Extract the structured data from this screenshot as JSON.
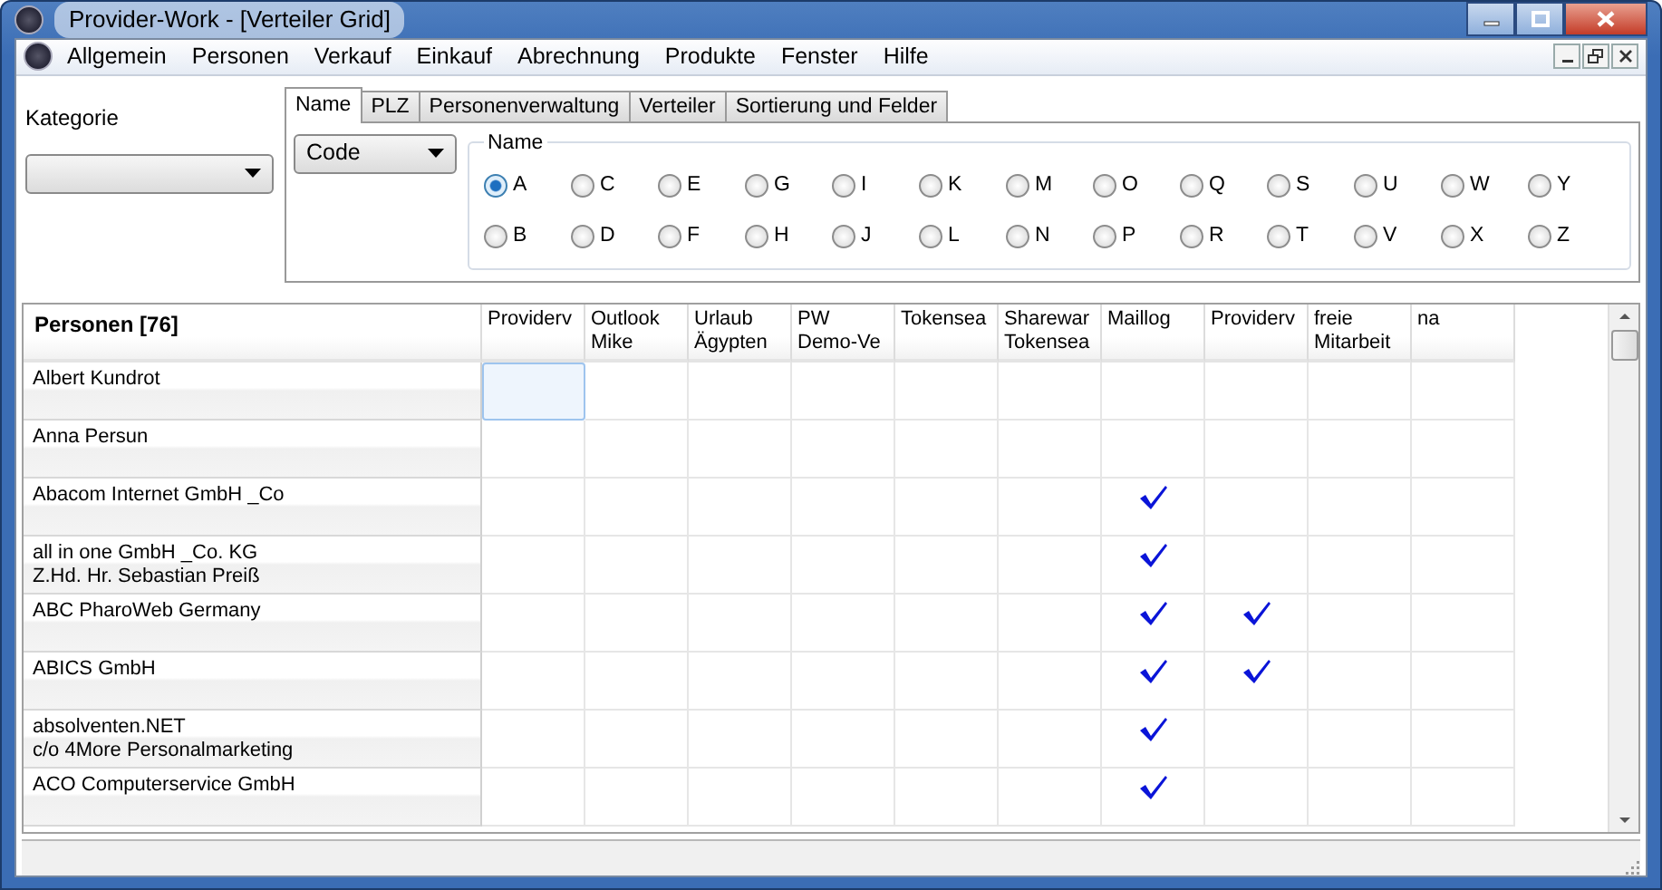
{
  "window": {
    "title": "Provider-Work - [Verteiler Grid]"
  },
  "menu": [
    {
      "label": "Allgemein"
    },
    {
      "label": "Personen"
    },
    {
      "label": "Verkauf"
    },
    {
      "label": "Einkauf"
    },
    {
      "label": "Abrechnung"
    },
    {
      "label": "Produkte"
    },
    {
      "label": "Fenster"
    },
    {
      "label": "Hilfe"
    }
  ],
  "kategorie": {
    "label": "Kategorie"
  },
  "tabs": [
    {
      "label": "Name",
      "selected": true
    },
    {
      "label": "PLZ",
      "selected": false
    },
    {
      "label": "Personenverwaltung",
      "selected": false
    },
    {
      "label": "Verteiler",
      "selected": false
    },
    {
      "label": "Sortierung und Felder",
      "selected": false
    }
  ],
  "sort_combo": {
    "value": "Code"
  },
  "name_group": {
    "title": "Name",
    "options": [
      {
        "label": "A",
        "selected": true
      },
      {
        "label": "B",
        "selected": false
      },
      {
        "label": "C",
        "selected": false
      },
      {
        "label": "D",
        "selected": false
      },
      {
        "label": "E",
        "selected": false
      },
      {
        "label": "F",
        "selected": false
      },
      {
        "label": "G",
        "selected": false
      },
      {
        "label": "H",
        "selected": false
      },
      {
        "label": "I",
        "selected": false
      },
      {
        "label": "J",
        "selected": false
      },
      {
        "label": "K",
        "selected": false
      },
      {
        "label": "L",
        "selected": false
      },
      {
        "label": "M",
        "selected": false
      },
      {
        "label": "N",
        "selected": false
      },
      {
        "label": "O",
        "selected": false
      },
      {
        "label": "P",
        "selected": false
      },
      {
        "label": "Q",
        "selected": false
      },
      {
        "label": "R",
        "selected": false
      },
      {
        "label": "S",
        "selected": false
      },
      {
        "label": "T",
        "selected": false
      },
      {
        "label": "U",
        "selected": false
      },
      {
        "label": "V",
        "selected": false
      },
      {
        "label": "W",
        "selected": false
      },
      {
        "label": "X",
        "selected": false
      },
      {
        "label": "Y",
        "selected": false
      },
      {
        "label": "Z",
        "selected": false
      }
    ]
  },
  "table": {
    "corner": "Personen [76]",
    "columns": [
      "Providerv",
      "Outlook\nMike",
      "Urlaub\nÄgypten",
      "PW\nDemo-Ve",
      "Tokensea",
      "Sharewar\nTokensea",
      "Maillog",
      "Providerv",
      "freie\nMitarbeit",
      "na"
    ],
    "rows": [
      {
        "name": "Albert Kundrot",
        "cells": [
          {
            "checked": false,
            "selected": true
          },
          {
            "checked": false,
            "selected": false
          },
          {
            "checked": false,
            "selected": false
          },
          {
            "checked": false,
            "selected": false
          },
          {
            "checked": false,
            "selected": false
          },
          {
            "checked": false,
            "selected": false
          },
          {
            "checked": false,
            "selected": false
          },
          {
            "checked": false,
            "selected": false
          },
          {
            "checked": false,
            "selected": false
          },
          {
            "checked": false,
            "selected": false
          }
        ]
      },
      {
        "name": "Anna Persun",
        "cells": [
          {
            "checked": false,
            "selected": false
          },
          {
            "checked": false,
            "selected": false
          },
          {
            "checked": false,
            "selected": false
          },
          {
            "checked": false,
            "selected": false
          },
          {
            "checked": false,
            "selected": false
          },
          {
            "checked": false,
            "selected": false
          },
          {
            "checked": false,
            "selected": false
          },
          {
            "checked": false,
            "selected": false
          },
          {
            "checked": false,
            "selected": false
          },
          {
            "checked": false,
            "selected": false
          }
        ]
      },
      {
        "name": "Abacom Internet GmbH _Co",
        "cells": [
          {
            "checked": false,
            "selected": false
          },
          {
            "checked": false,
            "selected": false
          },
          {
            "checked": false,
            "selected": false
          },
          {
            "checked": false,
            "selected": false
          },
          {
            "checked": false,
            "selected": false
          },
          {
            "checked": false,
            "selected": false
          },
          {
            "checked": true,
            "selected": false
          },
          {
            "checked": false,
            "selected": false
          },
          {
            "checked": false,
            "selected": false
          },
          {
            "checked": false,
            "selected": false
          }
        ]
      },
      {
        "name": "all in one GmbH _Co. KG\nZ.Hd. Hr. Sebastian Preiß",
        "cells": [
          {
            "checked": false,
            "selected": false
          },
          {
            "checked": false,
            "selected": false
          },
          {
            "checked": false,
            "selected": false
          },
          {
            "checked": false,
            "selected": false
          },
          {
            "checked": false,
            "selected": false
          },
          {
            "checked": false,
            "selected": false
          },
          {
            "checked": true,
            "selected": false
          },
          {
            "checked": false,
            "selected": false
          },
          {
            "checked": false,
            "selected": false
          },
          {
            "checked": false,
            "selected": false
          }
        ]
      },
      {
        "name": "ABC PharoWeb Germany",
        "cells": [
          {
            "checked": false,
            "selected": false
          },
          {
            "checked": false,
            "selected": false
          },
          {
            "checked": false,
            "selected": false
          },
          {
            "checked": false,
            "selected": false
          },
          {
            "checked": false,
            "selected": false
          },
          {
            "checked": false,
            "selected": false
          },
          {
            "checked": true,
            "selected": false
          },
          {
            "checked": true,
            "selected": false
          },
          {
            "checked": false,
            "selected": false
          },
          {
            "checked": false,
            "selected": false
          }
        ]
      },
      {
        "name": "ABICS GmbH",
        "cells": [
          {
            "checked": false,
            "selected": false
          },
          {
            "checked": false,
            "selected": false
          },
          {
            "checked": false,
            "selected": false
          },
          {
            "checked": false,
            "selected": false
          },
          {
            "checked": false,
            "selected": false
          },
          {
            "checked": false,
            "selected": false
          },
          {
            "checked": true,
            "selected": false
          },
          {
            "checked": true,
            "selected": false
          },
          {
            "checked": false,
            "selected": false
          },
          {
            "checked": false,
            "selected": false
          }
        ]
      },
      {
        "name": "absolventen.NET\nc/o 4More Personalmarketing",
        "cells": [
          {
            "checked": false,
            "selected": false
          },
          {
            "checked": false,
            "selected": false
          },
          {
            "checked": false,
            "selected": false
          },
          {
            "checked": false,
            "selected": false
          },
          {
            "checked": false,
            "selected": false
          },
          {
            "checked": false,
            "selected": false
          },
          {
            "checked": true,
            "selected": false
          },
          {
            "checked": false,
            "selected": false
          },
          {
            "checked": false,
            "selected": false
          },
          {
            "checked": false,
            "selected": false
          }
        ]
      },
      {
        "name": "ACO Computerservice GmbH",
        "cells": [
          {
            "checked": false,
            "selected": false
          },
          {
            "checked": false,
            "selected": false
          },
          {
            "checked": false,
            "selected": false
          },
          {
            "checked": false,
            "selected": false
          },
          {
            "checked": false,
            "selected": false
          },
          {
            "checked": false,
            "selected": false
          },
          {
            "checked": true,
            "selected": false
          },
          {
            "checked": false,
            "selected": false
          },
          {
            "checked": false,
            "selected": false
          },
          {
            "checked": false,
            "selected": false
          }
        ]
      }
    ]
  }
}
